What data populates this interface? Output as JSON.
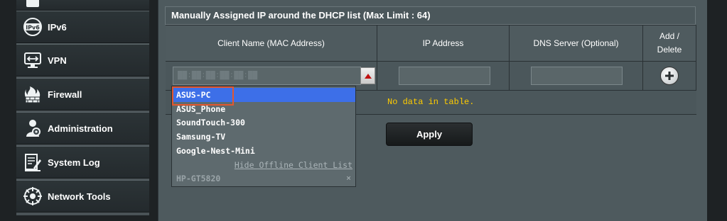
{
  "sidebar": {
    "items": [
      {
        "label": "IPv6",
        "icon": "ipv6-icon"
      },
      {
        "label": "VPN",
        "icon": "vpn-icon"
      },
      {
        "label": "Firewall",
        "icon": "firewall-icon"
      },
      {
        "label": "Administration",
        "icon": "administration-icon"
      },
      {
        "label": "System Log",
        "icon": "system-log-icon"
      },
      {
        "label": "Network Tools",
        "icon": "network-tools-icon"
      }
    ]
  },
  "panel": {
    "title": "Manually Assigned IP around the DHCP list (Max Limit : 64)",
    "columns": {
      "client": "Client Name (MAC Address)",
      "ip": "IP Address",
      "dns": "DNS Server (Optional)",
      "add_delete_1": "Add /",
      "add_delete_2": "Delete"
    },
    "mac_value": "██:██:██:██:██:██",
    "no_data": "No data in table.",
    "apply_label": "Apply"
  },
  "dropdown": {
    "items": [
      "ASUS-PC",
      "ASUS_Phone",
      "SoundTouch-300",
      "Samsung-TV",
      "Google-Nest-Mini"
    ],
    "selected_index": 0,
    "hide_offline_label": "Hide Offline Client List",
    "offline_item": "HP-GT5820",
    "offline_remove": "×"
  },
  "colors": {
    "selected_highlight": "#3d6fe8",
    "no_data_text": "#ffcc00",
    "annotation_box": "#e4572e"
  }
}
